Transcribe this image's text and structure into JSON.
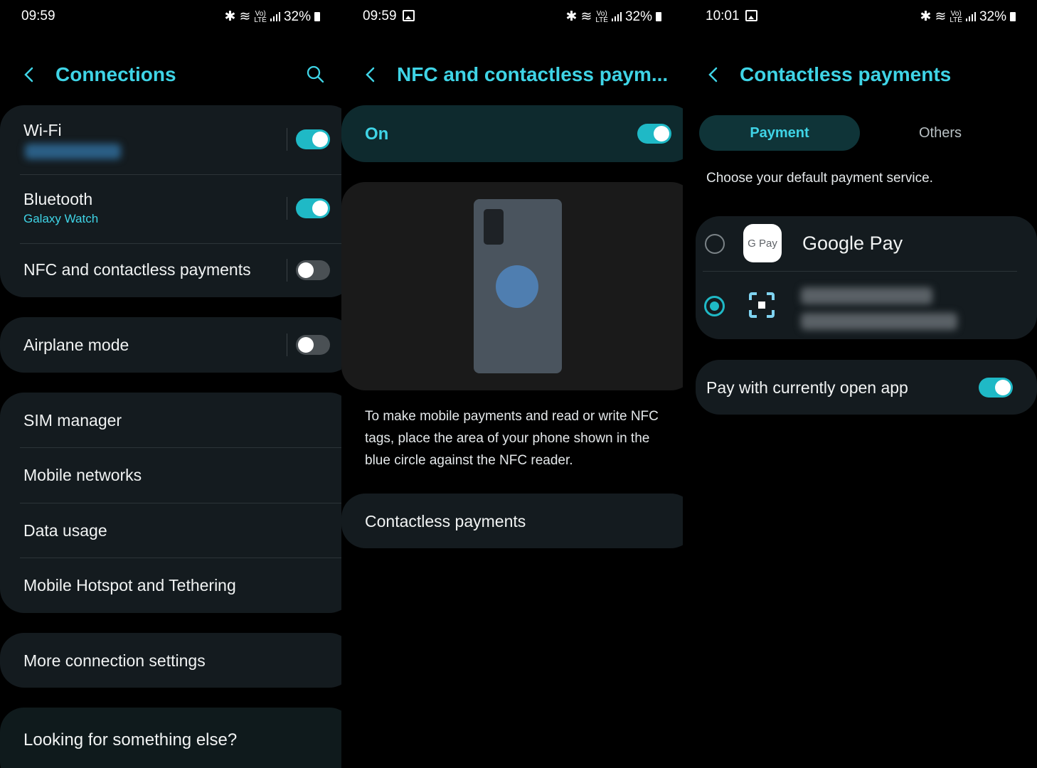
{
  "panel1": {
    "status": {
      "time": "09:59",
      "battery": "32%"
    },
    "title": "Connections",
    "items": [
      {
        "label": "Wi-Fi",
        "sub_hidden": "Hidden network name",
        "toggle": "on"
      },
      {
        "label": "Bluetooth",
        "sub": "Galaxy Watch",
        "toggle": "on"
      },
      {
        "label": "NFC and contactless payments",
        "toggle": "off"
      },
      {
        "label": "Airplane mode",
        "toggle": "off"
      },
      {
        "label": "SIM manager"
      },
      {
        "label": "Mobile networks"
      },
      {
        "label": "Data usage"
      },
      {
        "label": "Mobile Hotspot and Tethering"
      },
      {
        "label": "More connection settings"
      },
      {
        "label": "Looking for something else?"
      }
    ]
  },
  "panel2": {
    "status": {
      "time": "09:59",
      "battery": "32%"
    },
    "title": "NFC and contactless paym...",
    "master_label": "On",
    "description": "To make mobile payments and read or write NFC tags, place the area of your phone shown in the blue circle against the NFC reader.",
    "contactless_label": "Contactless payments"
  },
  "panel3": {
    "status": {
      "time": "10:01",
      "battery": "32%"
    },
    "title": "Contactless payments",
    "tabs": [
      "Payment",
      "Others"
    ],
    "choose_text": "Choose your default payment service.",
    "services": [
      {
        "name": "Google Pay",
        "icon": "G Pay",
        "selected": false
      },
      {
        "name": "Hidden payment service name",
        "selected": true
      }
    ],
    "pay_open_app_label": "Pay with currently open app"
  },
  "colors": {
    "accent": "#3fd4e6",
    "toggle_on": "#1fb9c6",
    "card": "#141b1f"
  }
}
